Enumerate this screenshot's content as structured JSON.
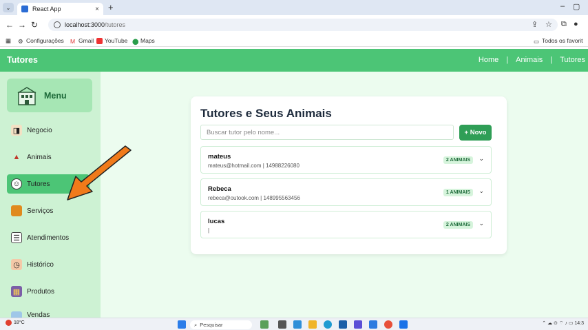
{
  "browser": {
    "tab_title": "React App",
    "tab_close": "×",
    "new_tab": "+",
    "url_host": "localhost:3000",
    "url_path": "/tutores",
    "bookmarks": [
      "Configurações",
      "Gmail",
      "YouTube",
      "Maps"
    ],
    "bookmarks_right": "Todos os favorit"
  },
  "app": {
    "brand": "Tutores",
    "nav": [
      "Home",
      "Animais",
      "Tutores"
    ],
    "nav_sep": "|"
  },
  "sidebar": {
    "menu_title": "Menu",
    "items": [
      {
        "label": "Negocio",
        "icon": "business-icon"
      },
      {
        "label": "Animais",
        "icon": "animals-icon"
      },
      {
        "label": "Tutores",
        "icon": "tutor-icon",
        "active": true
      },
      {
        "label": "Serviços",
        "icon": "services-icon"
      },
      {
        "label": "Atendimentos",
        "icon": "clipboard-icon"
      },
      {
        "label": "Histórico",
        "icon": "calendar-icon"
      },
      {
        "label": "Produtos",
        "icon": "products-icon"
      },
      {
        "label": "Vendas",
        "icon": "sales-icon"
      }
    ]
  },
  "main": {
    "title": "Tutores e Seus Animais",
    "search_placeholder": "Buscar tutor pelo nome...",
    "new_button": "+ Novo",
    "tutors": [
      {
        "name": "mateus",
        "info": "mateus@hotmail.com | 14988226080",
        "badge": "2 ANIMAIS"
      },
      {
        "name": "Rebeca",
        "info": "rebeca@outook.com | 148995563456",
        "badge": "1 ANIMAIS"
      },
      {
        "name": "lucas",
        "info": "|",
        "badge": "2 ANIMAIS"
      }
    ]
  },
  "taskbar": {
    "temperature": "18°C",
    "search": "Pesquisar",
    "time": "14:3"
  },
  "colors": {
    "accent": "#4cc576",
    "button": "#2f9e56",
    "sidebar_bg": "#cdf2d3",
    "main_bg": "#ecfcef",
    "arrow": "#f07a1a"
  }
}
